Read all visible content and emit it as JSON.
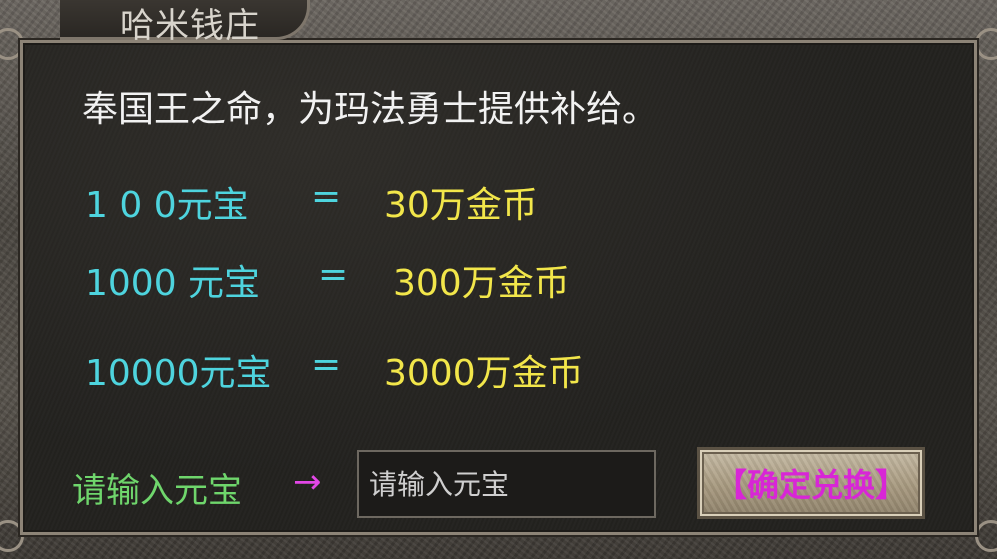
{
  "window": {
    "title": "哈米钱庄"
  },
  "intro": "奉国王之命，为玛法勇士提供补给。",
  "rates": [
    {
      "yuanbao": "1 0 0元宝",
      "equals": "=",
      "gold": "30万金币"
    },
    {
      "yuanbao": "1000 元宝",
      "equals": "=",
      "gold": "300万金币"
    },
    {
      "yuanbao": "10000元宝",
      "equals": "=",
      "gold": "3000万金币"
    }
  ],
  "exchange": {
    "prompt": "请输入元宝",
    "arrow": "→",
    "input_value": "",
    "input_placeholder": "请输入元宝",
    "confirm_label": "【确定兑换】"
  },
  "colors": {
    "intro_text": "#f2f2f2",
    "yuanbao_text": "#4ed4de",
    "gold_text": "#f2e64a",
    "prompt_text": "#6fd66c",
    "arrow": "#e247e6",
    "confirm_text": "#d826d6"
  }
}
